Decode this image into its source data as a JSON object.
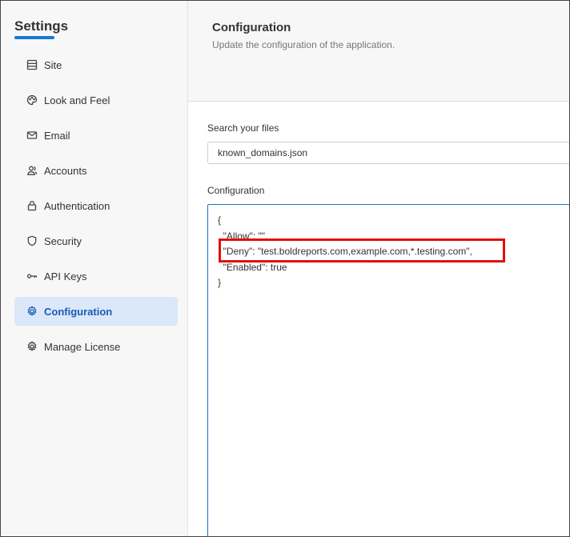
{
  "sidebar": {
    "title": "Settings",
    "accent_color": "#1976d2",
    "items": [
      {
        "label": "Site",
        "icon": "server-icon",
        "active": false
      },
      {
        "label": "Look and Feel",
        "icon": "palette-icon",
        "active": false
      },
      {
        "label": "Email",
        "icon": "mail-icon",
        "active": false
      },
      {
        "label": "Accounts",
        "icon": "users-icon",
        "active": false
      },
      {
        "label": "Authentication",
        "icon": "lock-icon",
        "active": false
      },
      {
        "label": "Security",
        "icon": "shield-icon",
        "active": false
      },
      {
        "label": "API Keys",
        "icon": "key-icon",
        "active": false
      },
      {
        "label": "Configuration",
        "icon": "gear-icon",
        "active": true
      },
      {
        "label": "Manage License",
        "icon": "license-gear-icon",
        "active": false
      }
    ]
  },
  "header": {
    "title": "Configuration",
    "subtitle": "Update the configuration of the application."
  },
  "search": {
    "label": "Search your files",
    "value": "known_domains.json"
  },
  "configuration": {
    "label": "Configuration",
    "lines": [
      "{",
      "  \"Allow\": \"\",",
      "  \"Deny\": \"test.boldreports.com,example.com,*.testing.com\",",
      "  \"Enabled\": true",
      "}"
    ],
    "highlight_color": "#e01010"
  }
}
